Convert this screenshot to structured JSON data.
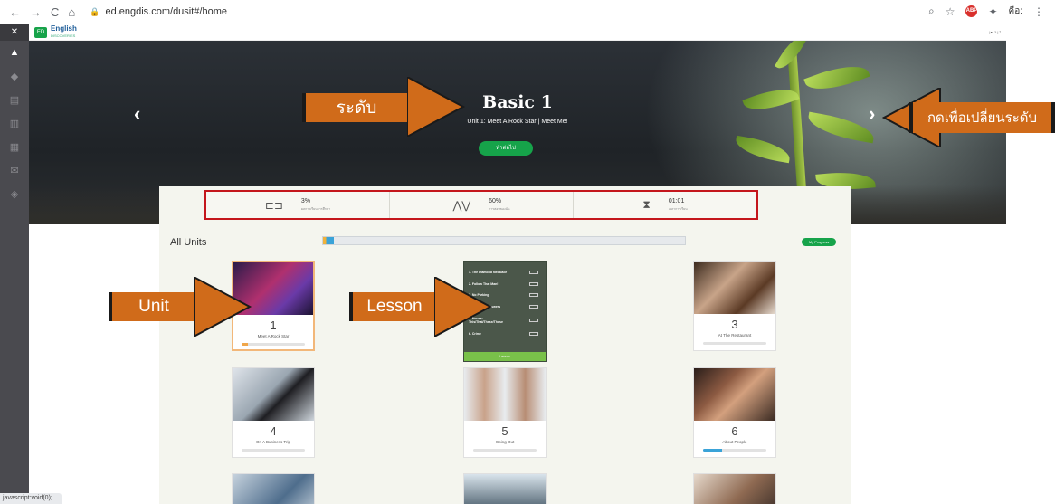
{
  "browser": {
    "url": "ed.engdis.com/dusit#/home",
    "extension_label": "คือ:",
    "status_text": "javascript:void(0);"
  },
  "app": {
    "brand": "English",
    "brand_sub": "DISCOVERIES"
  },
  "hero": {
    "level_title": "Basic 1",
    "unit_subtitle": "Unit 1: Meet A Rock Star | Meet Me!",
    "continue_label": "ทำต่อไป"
  },
  "stats": [
    {
      "icon": "course-progress-icon",
      "value": "3%",
      "label": "ผลการเรียนการศึกษา"
    },
    {
      "icon": "test-score-icon",
      "value": "60%",
      "label": "การสอบของฉัน"
    },
    {
      "icon": "time-spent-icon",
      "value": "01:01",
      "label": "เวลาการเรียน"
    }
  ],
  "main": {
    "heading": "All Units",
    "overall_progress": 0.03,
    "my_progress_label": "My Progress"
  },
  "units": [
    {
      "number": "1",
      "name": "Meet A Rock Star",
      "progress": 0.1
    },
    {
      "number": "3",
      "name": "At The Restaurant",
      "progress": 0
    },
    {
      "number": "4",
      "name": "On A Business Trip",
      "progress": 0
    },
    {
      "number": "5",
      "name": "Going Out",
      "progress": 0
    },
    {
      "number": "6",
      "name": "About People",
      "progress": 0.3
    }
  ],
  "lesson_list": {
    "items": [
      "1. The Diamond Necklace",
      "2. Follow That Man!",
      "3. No Parking",
      "4. No. Short Answers",
      "5. Nouns: This/That/These/Those",
      "6. Crime"
    ],
    "footer": "Lesson"
  },
  "annotations": {
    "level": "ระดับ",
    "change_level": "กดเพื่อเปลี่ยนระดับ",
    "unit": "Unit",
    "lesson": "Lesson"
  },
  "colors": {
    "accent_green": "#16a34a",
    "callout_orange": "#d06b1a",
    "highlight_red": "#c4161c"
  }
}
